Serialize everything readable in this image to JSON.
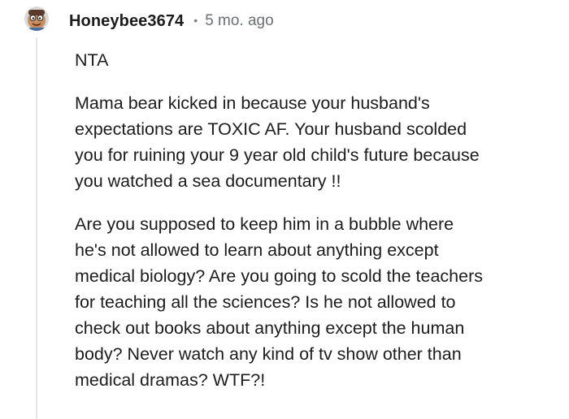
{
  "comment": {
    "author": "Honeybee3674",
    "separator": "•",
    "timestamp": "5 mo. ago",
    "avatar_icon": "cartoon-avatar-icon",
    "paragraphs": [
      {
        "lines": [
          "NTA"
        ]
      },
      {
        "lines": [
          "Mama bear kicked in because your husband's",
          "expectations are TOXIC AF. Your husband scolded",
          "you for ruining your 9 year old child's future because",
          "you watched a sea documentary !!"
        ]
      },
      {
        "lines": [
          "Are you supposed to keep him in a bubble where",
          "he's not allowed to learn about anything except",
          "medical biology? Are you going to scold the teachers",
          "for teaching all the sciences? Is he not allowed to",
          "check out books about anything except the human",
          "body? Never watch any kind of tv show other than",
          "medical dramas? WTF?!"
        ]
      }
    ]
  },
  "colors": {
    "text": "#1c1c1c",
    "meta": "#6a6f72",
    "thread_line": "#e4e6e8",
    "avatar_bg": "#c8905e"
  }
}
